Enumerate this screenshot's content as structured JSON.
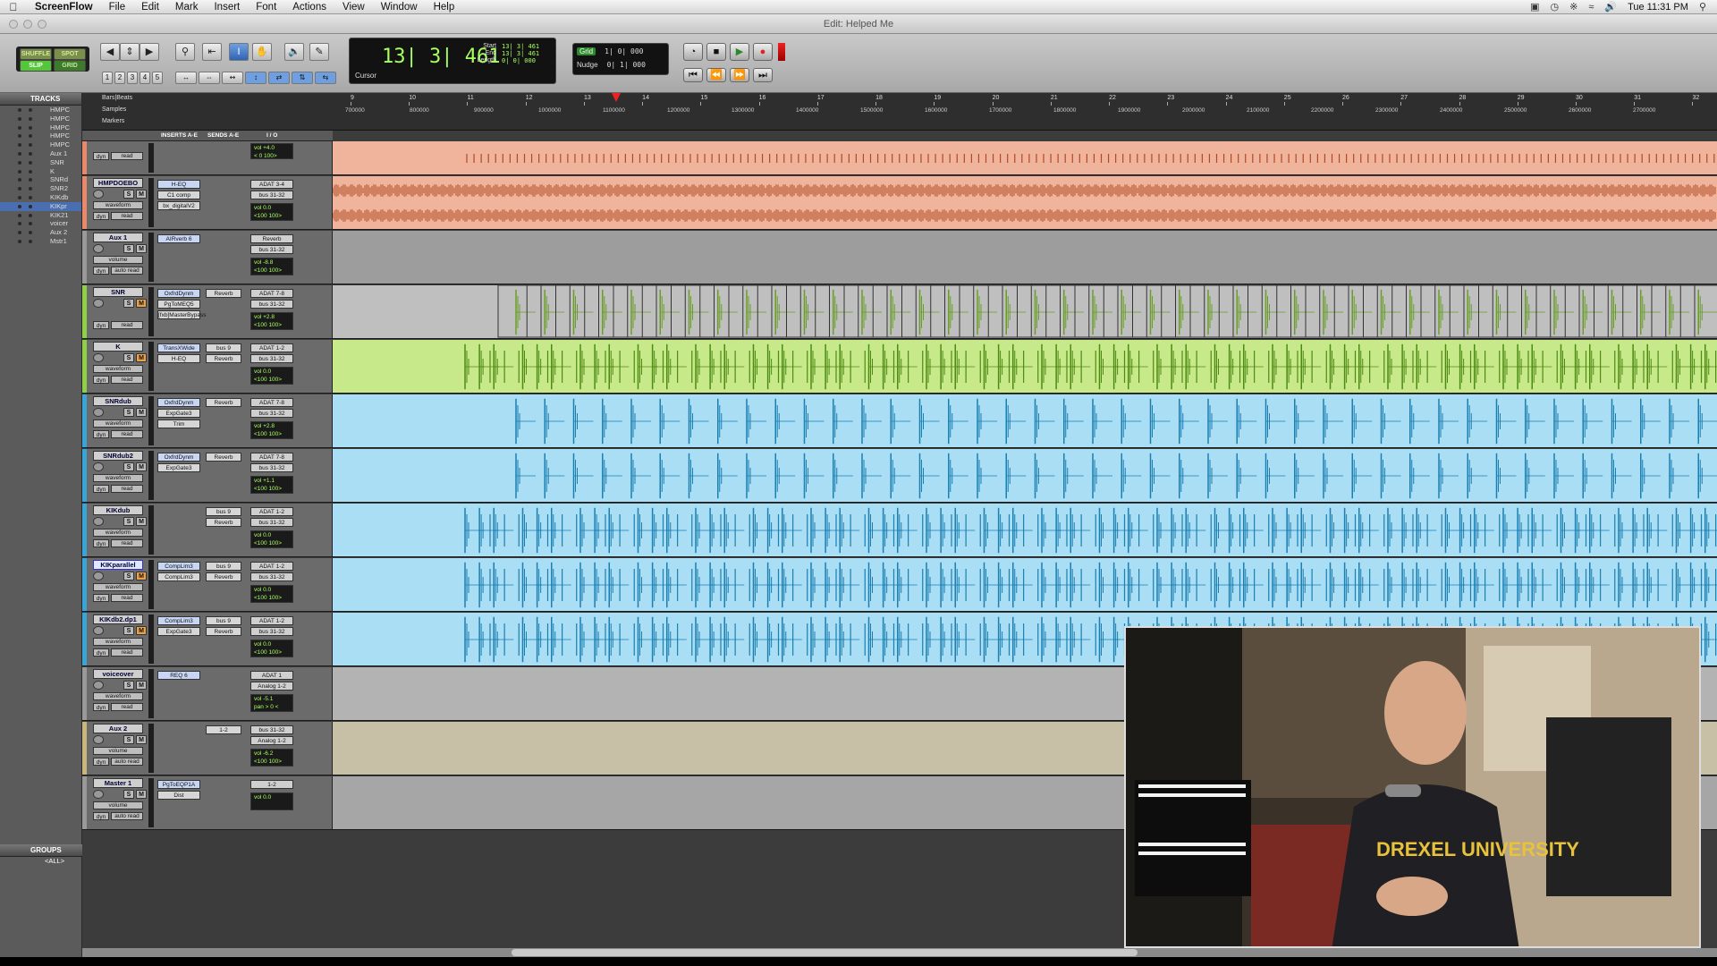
{
  "menubar": {
    "app_name": "ScreenFlow",
    "items": [
      "File",
      "Edit",
      "Mark",
      "Insert",
      "Font",
      "Actions",
      "View",
      "Window",
      "Help"
    ],
    "clock": "Tue 11:31 PM"
  },
  "window": {
    "title": "Edit: Helped Me"
  },
  "toolbar": {
    "modes": {
      "shuffle": "SHUFFLE",
      "spot": "SPOT",
      "slip": "SLIP",
      "grid": "GRID"
    },
    "zoom_presets": [
      "1",
      "2",
      "3",
      "4",
      "5"
    ],
    "counter": {
      "main": "13| 3| 461",
      "cursor_label": "Cursor",
      "start_label": "Start",
      "end_label": "End",
      "length_label": "Length",
      "start": "13| 3| 461",
      "end": "13| 3| 461",
      "length": "0| 0| 000"
    },
    "grid": {
      "label": "Grid",
      "value": "1| 0| 000"
    },
    "nudge": {
      "label": "Nudge",
      "value": "0| 1| 000"
    }
  },
  "sidebar": {
    "tracks_header": "TRACKS",
    "tracks": [
      "HMPC",
      "HMPC",
      "HMPC",
      "HMPC",
      "HMPC",
      "Aux 1",
      "SNR",
      "K",
      "SNRd",
      "SNR2",
      "KIKdb",
      "KIKpr",
      "KIK21",
      "voicer",
      "Aux 2",
      "Mstr1"
    ],
    "selected_index": 11,
    "groups_header": "GROUPS",
    "groups": [
      "<ALL>"
    ]
  },
  "rulers": {
    "bars_label": "Bars|Beats",
    "samples_label": "Samples",
    "markers_label": "Markers",
    "bars": [
      "9",
      "10",
      "11",
      "12",
      "13",
      "14",
      "15",
      "16",
      "17",
      "18",
      "19",
      "20",
      "21",
      "22",
      "23",
      "24",
      "25",
      "26",
      "27",
      "28",
      "29",
      "30",
      "31",
      "32"
    ],
    "samples": [
      "700000",
      "800000",
      "900000",
      "1000000",
      "1100000",
      "1200000",
      "1300000",
      "1400000",
      "1500000",
      "1600000",
      "1700000",
      "1800000",
      "1900000",
      "2000000",
      "2100000",
      "2200000",
      "2300000",
      "2400000",
      "2500000",
      "2600000",
      "2700000"
    ]
  },
  "columns": {
    "inserts": "INSERTS A-E",
    "sends": "SENDS A-E",
    "io": "I / O"
  },
  "tracks": [
    {
      "name": "",
      "color": "#e88a6a",
      "lane_color": "#f0b49c",
      "wave_color": "#b04a22",
      "view": "",
      "auto": "read",
      "inserts": [],
      "sends": [],
      "io_out": "",
      "vol": "vol   +4.0",
      "pan": "< 0     100>",
      "m_on": false,
      "kind": "ticks"
    },
    {
      "name": "HMPDOEBO",
      "color": "#e88a6a",
      "lane_color": "#f0b49c",
      "wave_color": "#b04a22",
      "view": "waveform",
      "auto": "read",
      "inserts": [
        "H-EQ",
        "C1 comp",
        "bx_digitalV2"
      ],
      "sends": [],
      "io_in": "ADAT 3-4",
      "io_out": "bus 31-32",
      "vol": "vol   0.0",
      "pan": "<100   100>",
      "m_on": false,
      "kind": "dense"
    },
    {
      "name": "Aux 1",
      "color": "#9a9a9a",
      "lane_color": "#9d9d9d",
      "wave_color": "#555",
      "view": "volume",
      "auto": "auto read",
      "inserts": [
        "AIRverb 6"
      ],
      "sends": [],
      "io_in": "Reverb",
      "io_out": "bus 31-32",
      "vol": "vol   -8.8",
      "pan": "<100   100>",
      "m_on": false,
      "kind": "none"
    },
    {
      "name": "SNR",
      "color": "#8fcf4a",
      "lane_color": "#bfbfbf",
      "wave_color": "#6a9d28",
      "view": "",
      "auto": "read",
      "inserts": [
        "OxfrdDynm",
        "PgToMEQ5",
        "[fxb]MasterBypass"
      ],
      "sends": [
        "Reverb"
      ],
      "io_in": "ADAT 7-8",
      "io_out": "bus 31-32",
      "vol": "vol   +2.8",
      "pan": "<100   100>",
      "m_on": true,
      "kind": "snr"
    },
    {
      "name": "K",
      "color": "#8fcf4a",
      "lane_color": "#c7e98a",
      "wave_color": "#4d8a14",
      "view": "waveform",
      "auto": "read",
      "inserts": [
        "TransXWide",
        "H-EQ"
      ],
      "sends": [
        "bus 9",
        "Reverb"
      ],
      "io_in": "ADAT 1-2",
      "io_out": "bus 31-32",
      "vol": "vol   0.0",
      "pan": "<100   100>",
      "m_on": true,
      "kind": "kick"
    },
    {
      "name": "SNRdub",
      "color": "#3aa6d8",
      "lane_color": "#a9def5",
      "wave_color": "#1b7fb0",
      "view": "waveform",
      "auto": "read",
      "inserts": [
        "OxfrdDynm",
        "ExpGate3",
        "Trim"
      ],
      "sends": [
        "Reverb"
      ],
      "io_in": "ADAT 7-8",
      "io_out": "bus 31-32",
      "vol": "vol   +2.8",
      "pan": "<100   100>",
      "m_on": false,
      "kind": "snrhit"
    },
    {
      "name": "SNRdub2",
      "color": "#3aa6d8",
      "lane_color": "#a9def5",
      "wave_color": "#1b7fb0",
      "view": "waveform",
      "auto": "read",
      "inserts": [
        "OxfrdDynm",
        "ExpGate3"
      ],
      "sends": [
        "Reverb"
      ],
      "io_in": "ADAT 7-8",
      "io_out": "bus 31-32",
      "vol": "vol   +1.1",
      "pan": "<100   100>",
      "m_on": false,
      "kind": "snrhit"
    },
    {
      "name": "KIKdub",
      "color": "#3aa6d8",
      "lane_color": "#a9def5",
      "wave_color": "#1b7fb0",
      "view": "waveform",
      "auto": "read",
      "inserts": [],
      "sends": [
        "bus 9",
        "Reverb"
      ],
      "io_in": "ADAT 1-2",
      "io_out": "bus 31-32",
      "vol": "vol   0.0",
      "pan": "<100   100>",
      "m_on": false,
      "kind": "kick"
    },
    {
      "name": "KIKparallel",
      "color": "#3aa6d8",
      "lane_color": "#a9def5",
      "wave_color": "#1b7fb0",
      "view": "waveform",
      "auto": "read",
      "inserts": [
        "CompLim3",
        "CompLim3"
      ],
      "sends": [
        "bus 9",
        "Reverb"
      ],
      "io_in": "ADAT 1-2",
      "io_out": "bus 31-32",
      "vol": "vol   0.0",
      "pan": "<100   100>",
      "m_on": true,
      "kind": "kick",
      "selected": true
    },
    {
      "name": "KIKdb2.dp1",
      "color": "#3aa6d8",
      "lane_color": "#a9def5",
      "wave_color": "#1b7fb0",
      "view": "waveform",
      "auto": "read",
      "inserts": [
        "CompLim3",
        "ExpGate3"
      ],
      "sends": [
        "bus 9",
        "Reverb"
      ],
      "io_in": "ADAT 1-2",
      "io_out": "bus 31-32",
      "vol": "vol   0.0",
      "pan": "<100   100>",
      "m_on": true,
      "kind": "kick"
    },
    {
      "name": "voiceover",
      "color": "#9a9a9a",
      "lane_color": "#b3b3b3",
      "wave_color": "#555",
      "view": "waveform",
      "auto": "read",
      "inserts": [
        "REQ 6"
      ],
      "sends": [],
      "io_in": "ADAT 1",
      "io_out": "Analog 1-2",
      "vol": "vol   -5.1",
      "pan": "pan    > 0 <",
      "m_on": false,
      "kind": "none"
    },
    {
      "name": "Aux 2",
      "color": "#c9b678",
      "lane_color": "#c8c0a6",
      "wave_color": "#555",
      "view": "volume",
      "auto": "auto read",
      "inserts": [],
      "sends": [
        "1-2"
      ],
      "io_in": "bus 31-32",
      "io_out": "Analog 1-2",
      "vol": "vol   -6.2",
      "pan": "<100   100>",
      "m_on": false,
      "kind": "none"
    },
    {
      "name": "Master 1",
      "color": "#9a9a9a",
      "lane_color": "#a6a6a6",
      "wave_color": "#555",
      "view": "volume",
      "auto": "auto read",
      "inserts": [
        "PgToEQP1A",
        "Dist"
      ],
      "sends": [],
      "io_in": "1-2",
      "io_out": "",
      "vol": "vol   0.0",
      "pan": "",
      "m_on": false,
      "kind": "none"
    }
  ],
  "pip": {
    "shirt_text": "DREXEL UNIVERSITY"
  }
}
